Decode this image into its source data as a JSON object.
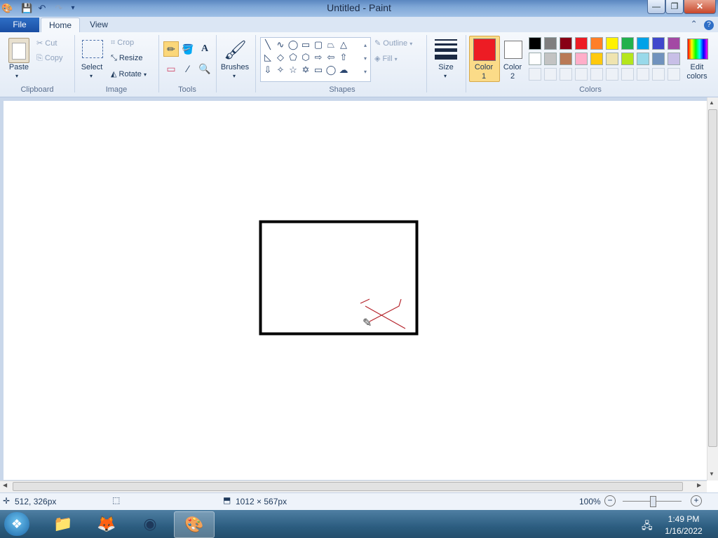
{
  "window": {
    "title": "Untitled - Paint"
  },
  "titlebar": {
    "qat_icons": [
      "paint-app-icon",
      "save-icon",
      "undo-icon",
      "redo-icon",
      "customize-qat-icon"
    ],
    "minimize": "—",
    "maximize": "❐",
    "close": "✕"
  },
  "tabs": {
    "file": "File",
    "home": "Home",
    "view": "View"
  },
  "ribbon": {
    "clipboard": {
      "label": "Clipboard",
      "paste": "Paste",
      "cut": "Cut",
      "copy": "Copy"
    },
    "image": {
      "label": "Image",
      "select": "Select",
      "crop": "Crop",
      "resize": "Resize",
      "rotate": "Rotate"
    },
    "tools": {
      "label": "Tools"
    },
    "brushes": {
      "label": "Brushes"
    },
    "shapes": {
      "label": "Shapes",
      "outline": "Outline",
      "fill": "Fill"
    },
    "size": {
      "label": "Size"
    },
    "colors": {
      "label": "Colors",
      "color1": "Color",
      "color1_num": "1",
      "color2": "Color",
      "color2_num": "2",
      "edit": "Edit",
      "edit2": "colors",
      "color1_value": "#ed1c24",
      "color2_value": "#ffffff",
      "palette_row1": [
        "#000000",
        "#7f7f7f",
        "#880015",
        "#ed1c24",
        "#ff7f27",
        "#fff200",
        "#22b14c",
        "#00a2e8",
        "#3f48cc",
        "#a349a4"
      ],
      "palette_row2": [
        "#ffffff",
        "#c3c3c3",
        "#b97a57",
        "#ffaec9",
        "#ffc90e",
        "#efe4b0",
        "#b5e61d",
        "#99d9ea",
        "#7092be",
        "#c8bfe7"
      ]
    }
  },
  "status": {
    "cursor_pos": "512, 326px",
    "canvas_size": "1012 × 567px",
    "zoom": "100%"
  },
  "tray": {
    "time": "1:49 PM",
    "date": "1/16/2022"
  }
}
